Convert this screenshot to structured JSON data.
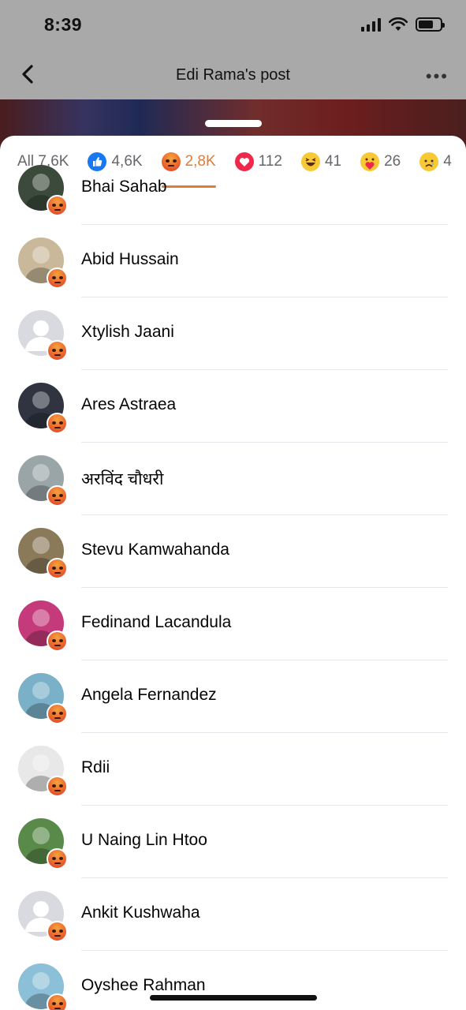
{
  "status": {
    "time": "8:39"
  },
  "header": {
    "title": "Edi Rama's post"
  },
  "tabs": [
    {
      "label": "All 7,6K",
      "icon": "",
      "active": false
    },
    {
      "label": "4,6K",
      "icon": "like-icon",
      "active": false
    },
    {
      "label": "2,8K",
      "icon": "angry-icon",
      "active": true
    },
    {
      "label": "112",
      "icon": "love-icon",
      "active": false
    },
    {
      "label": "41",
      "icon": "haha-icon",
      "active": false
    },
    {
      "label": "26",
      "icon": "care-icon",
      "active": false
    },
    {
      "label": "4",
      "icon": "sad-icon",
      "active": false
    }
  ],
  "colors": {
    "accent": "#e27b35",
    "divider": "#e4e6eb",
    "text": "#050505",
    "muted": "#65676b"
  },
  "people": [
    {
      "name": "Bhai Sahab",
      "avatar": "photo",
      "avatar_color": "#3b4a3a"
    },
    {
      "name": "Abid Hussain",
      "avatar": "photo",
      "avatar_color": "#c9b89a"
    },
    {
      "name": "Xtylish Jaani",
      "avatar": "default",
      "avatar_color": "#d8dadf"
    },
    {
      "name": "Ares Astraea",
      "avatar": "photo",
      "avatar_color": "#2f3440"
    },
    {
      "name": "अरविंद चौधरी",
      "avatar": "photo",
      "avatar_color": "#9aa5a8"
    },
    {
      "name": "Stevu Kamwahanda",
      "avatar": "photo",
      "avatar_color": "#8a7a5a"
    },
    {
      "name": "Fedinand Lacandula",
      "avatar": "photo",
      "avatar_color": "#c43a7a"
    },
    {
      "name": "Angela Fernandez",
      "avatar": "photo",
      "avatar_color": "#7ab0c8"
    },
    {
      "name": "Rdii",
      "avatar": "photo",
      "avatar_color": "#e8e8e8"
    },
    {
      "name": "U Naing Lin Htoo",
      "avatar": "photo",
      "avatar_color": "#5a8a4a"
    },
    {
      "name": "Ankit Kushwaha",
      "avatar": "default",
      "avatar_color": "#d8dadf"
    },
    {
      "name": "Oyshee Rahman",
      "avatar": "photo",
      "avatar_color": "#8cc0d8"
    }
  ]
}
